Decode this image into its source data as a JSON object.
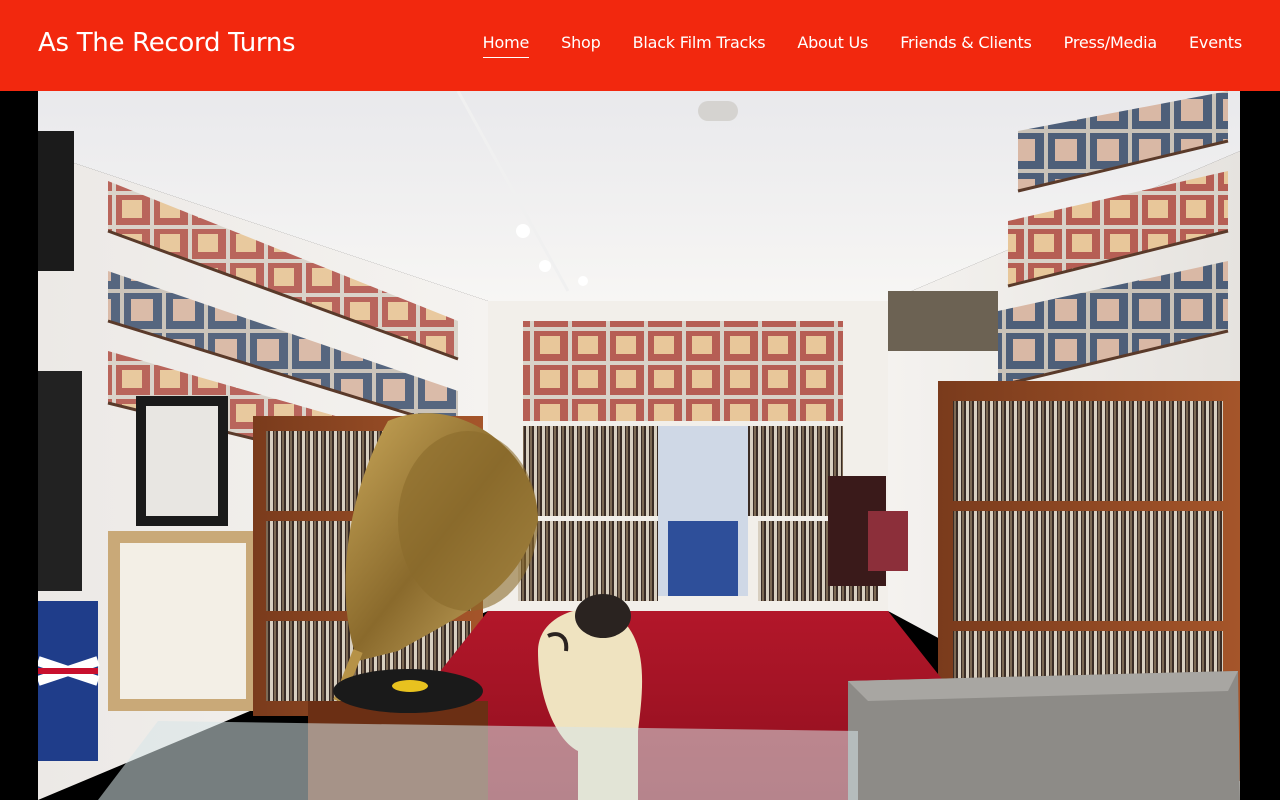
{
  "site": {
    "title": "As The Record Turns"
  },
  "nav": {
    "items": [
      {
        "label": "Home",
        "active": true
      },
      {
        "label": "Shop"
      },
      {
        "label": "Black Film Tracks"
      },
      {
        "label": "About Us"
      },
      {
        "label": "Friends & Clients"
      },
      {
        "label": "Press/Media"
      },
      {
        "label": "Events"
      }
    ]
  },
  "colors": {
    "header_bg": "#f2280e",
    "header_text": "#ffffff",
    "page_bg": "#000000"
  }
}
